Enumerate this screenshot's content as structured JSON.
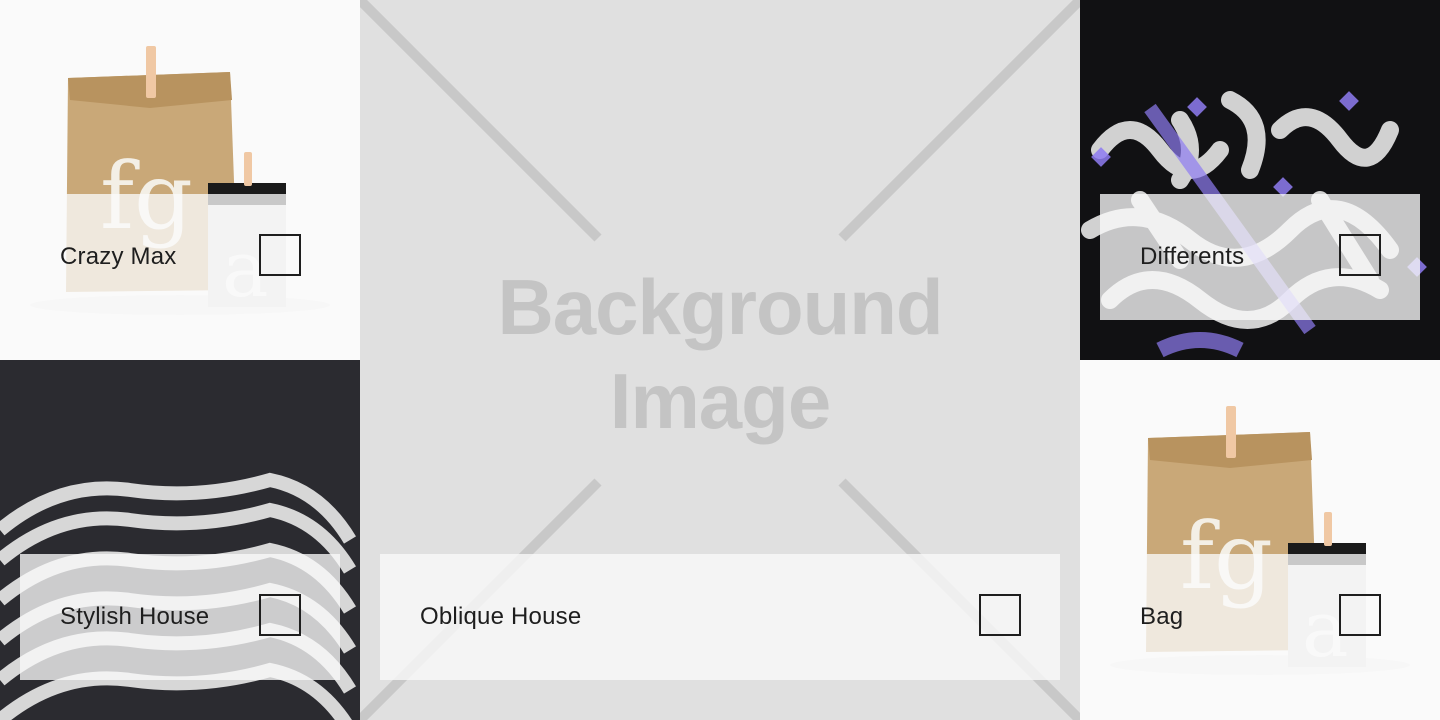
{
  "placeholder": {
    "line1": "Background",
    "line2": "Image"
  },
  "cards": {
    "crazy_max": {
      "label": "Crazy Max",
      "checked": false
    },
    "differents": {
      "label": "Differents",
      "checked": false
    },
    "stylish_house": {
      "label": "Stylish House",
      "checked": false
    },
    "oblique_house": {
      "label": "Oblique House",
      "checked": false
    },
    "bag": {
      "label": "Bag",
      "checked": false
    }
  },
  "bag_glyphs": {
    "big": "fg",
    "small": "a"
  },
  "colors": {
    "placeholder_bg": "#e0e0e0",
    "placeholder_ink": "#c4c4c4",
    "card_bg": "#fafafa",
    "text": "#1e1e1e",
    "kraft": "#c9a878",
    "accent_purple": "#8f7cf2"
  }
}
